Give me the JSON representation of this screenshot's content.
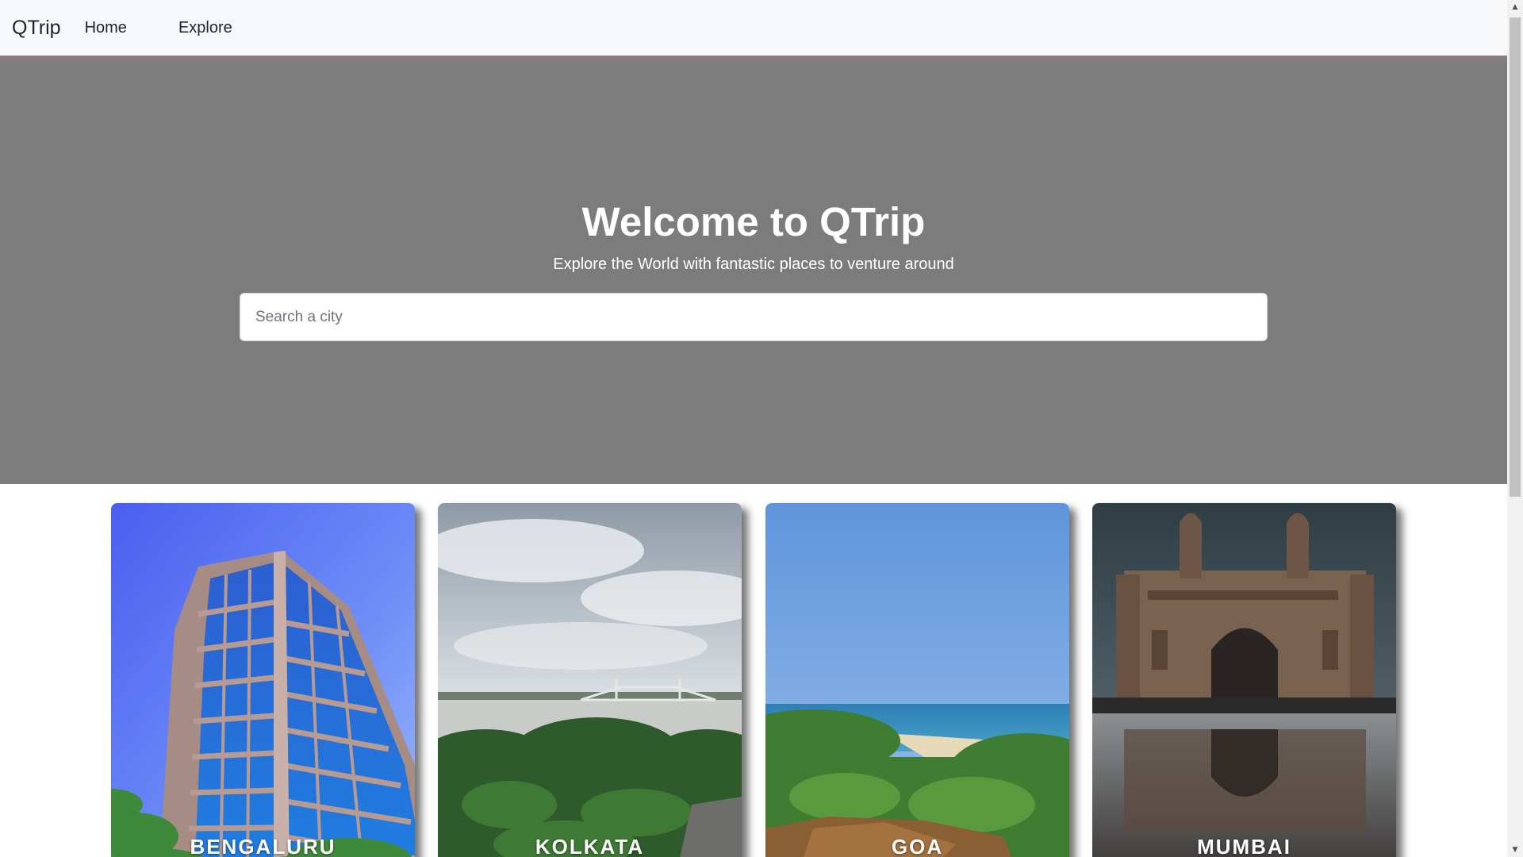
{
  "navbar": {
    "brand": "QTrip",
    "links": [
      {
        "label": "Home"
      },
      {
        "label": "Explore"
      }
    ]
  },
  "hero": {
    "title": "Welcome to QTrip",
    "subtitle": "Explore the World with fantastic places to venture around",
    "search": {
      "placeholder": "Search a city",
      "value": ""
    }
  },
  "cities": [
    {
      "name": "BENGALURU",
      "image": "office-building-photo"
    },
    {
      "name": "KOLKATA",
      "image": "howrah-bridge-river-photo"
    },
    {
      "name": "GOA",
      "image": "beach-coastline-photo"
    },
    {
      "name": "MUMBAI",
      "image": "gateway-of-india-photo"
    }
  ],
  "colors": {
    "navbar_bg": "#f8f9fa",
    "hero_overlay": "#7c7c7c",
    "text_light": "#ffffff",
    "text_dark": "#212529"
  },
  "scrollbar": {
    "up_icon": "scroll-up-arrow-icon",
    "down_icon": "scroll-down-arrow-icon"
  }
}
